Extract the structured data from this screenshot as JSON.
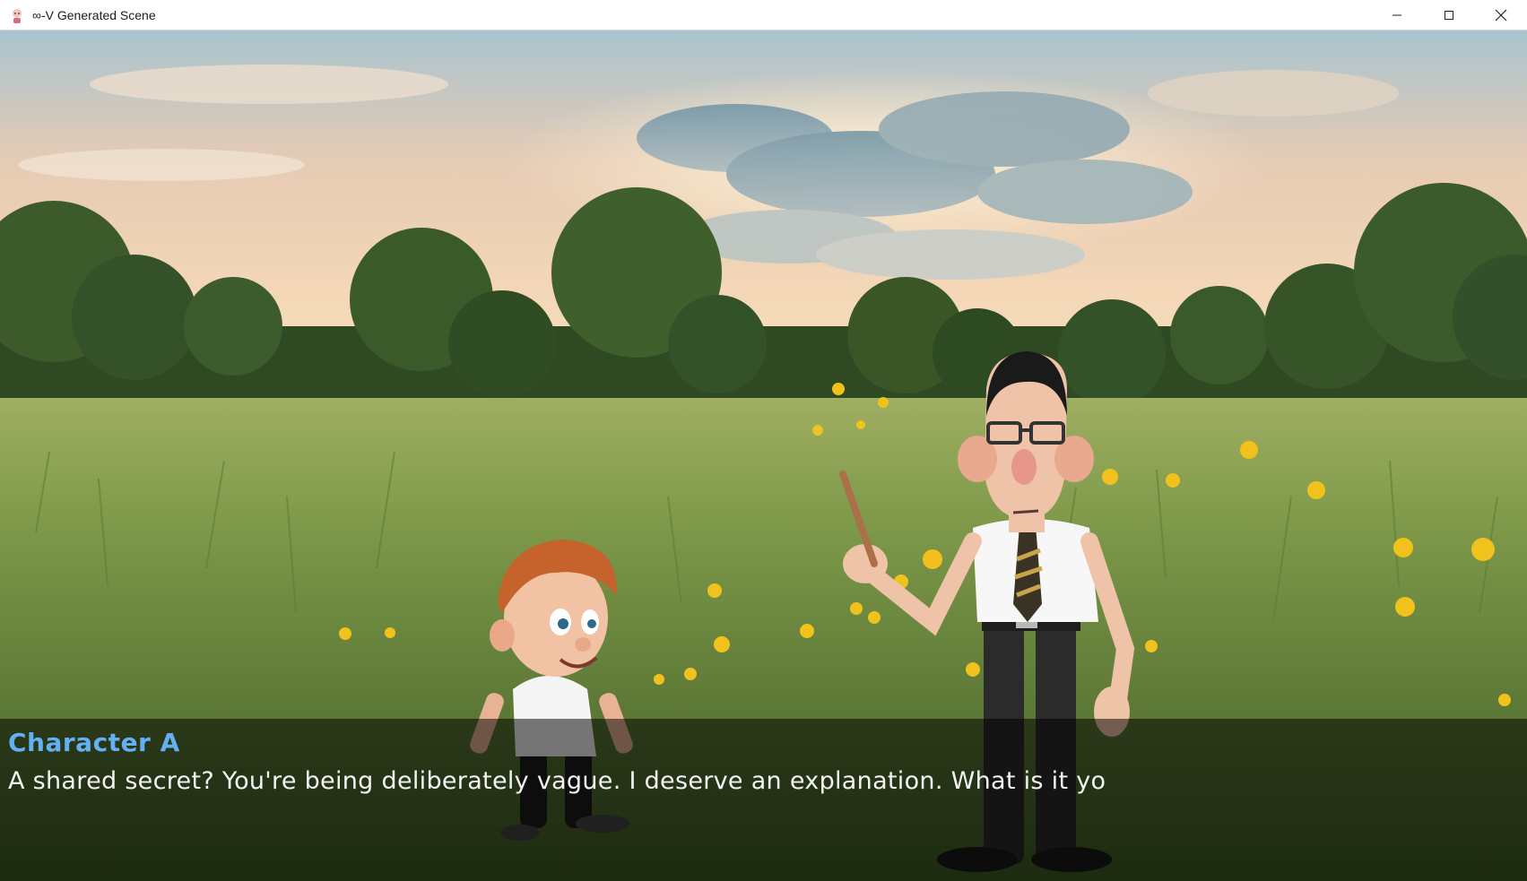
{
  "window": {
    "title": "∞-V Generated Scene",
    "icon": "app-character-icon",
    "controls": [
      "minimize-icon",
      "maximize-icon",
      "close-icon"
    ]
  },
  "scene": {
    "background": "meadow-sunset",
    "characters": [
      "boy-character",
      "man-character"
    ]
  },
  "dialogue": {
    "speaker": "Character A",
    "speaker_color": "#63b0f2",
    "text": "A shared secret? You're being deliberately vague. I deserve an explanation. What is it yo"
  }
}
